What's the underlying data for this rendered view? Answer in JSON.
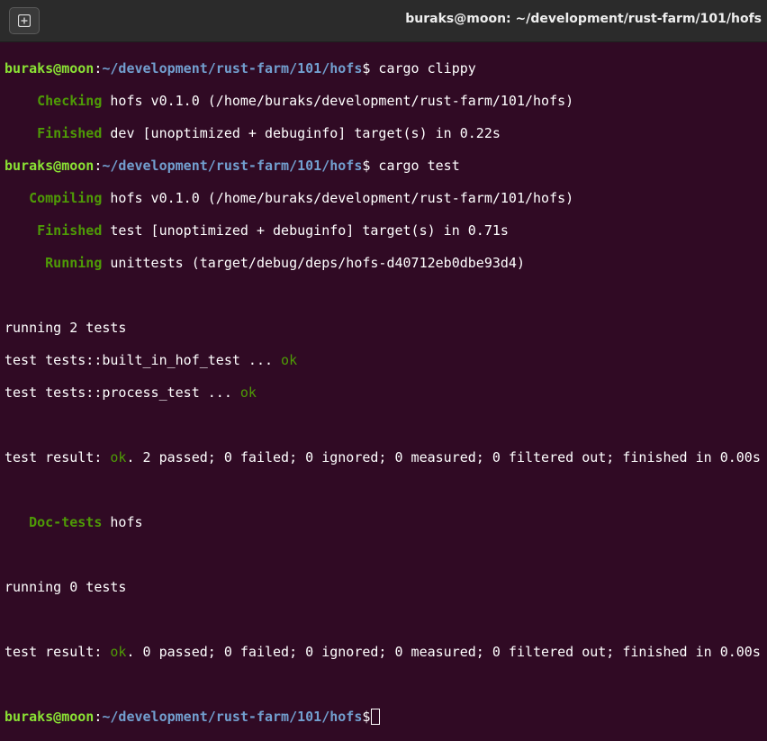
{
  "window": {
    "title": "buraks@moon: ~/development/rust-farm/101/hofs",
    "new_tab_icon": "new-tab-icon"
  },
  "prompt": {
    "user_host": "buraks@moon",
    "sep": ":",
    "path": "~/development/rust-farm/101/hofs",
    "symbol": "$"
  },
  "output": {
    "cmd1": " cargo clippy",
    "checking_label": "    Checking",
    "checking_text": " hofs v0.1.0 (/home/buraks/development/rust-farm/101/hofs)",
    "finished1_label": "    Finished",
    "finished1_text": " dev [unoptimized + debuginfo] target(s) in 0.22s",
    "cmd2": " cargo test",
    "compiling_label": "   Compiling",
    "compiling_text": " hofs v0.1.0 (/home/buraks/development/rust-farm/101/hofs)",
    "finished2_label": "    Finished",
    "finished2_text": " test [unoptimized + debuginfo] target(s) in 0.71s",
    "running_label": "     Running",
    "running_text": " unittests (target/debug/deps/hofs-d40712eb0dbe93d4)",
    "running2": "running 2 tests",
    "test1": "test tests::built_in_hof_test ... ",
    "test2": "test tests::process_test ... ",
    "ok": "ok",
    "result_prefix": "test result: ",
    "result1_suffix": ". 2 passed; 0 failed; 0 ignored; 0 measured; 0 filtered out; finished in 0.00s",
    "doctests_label": "   Doc-tests",
    "doctests_text": " hofs",
    "running0": "running 0 tests",
    "result2_suffix": ". 0 passed; 0 failed; 0 ignored; 0 measured; 0 filtered out; finished in 0.00s"
  }
}
